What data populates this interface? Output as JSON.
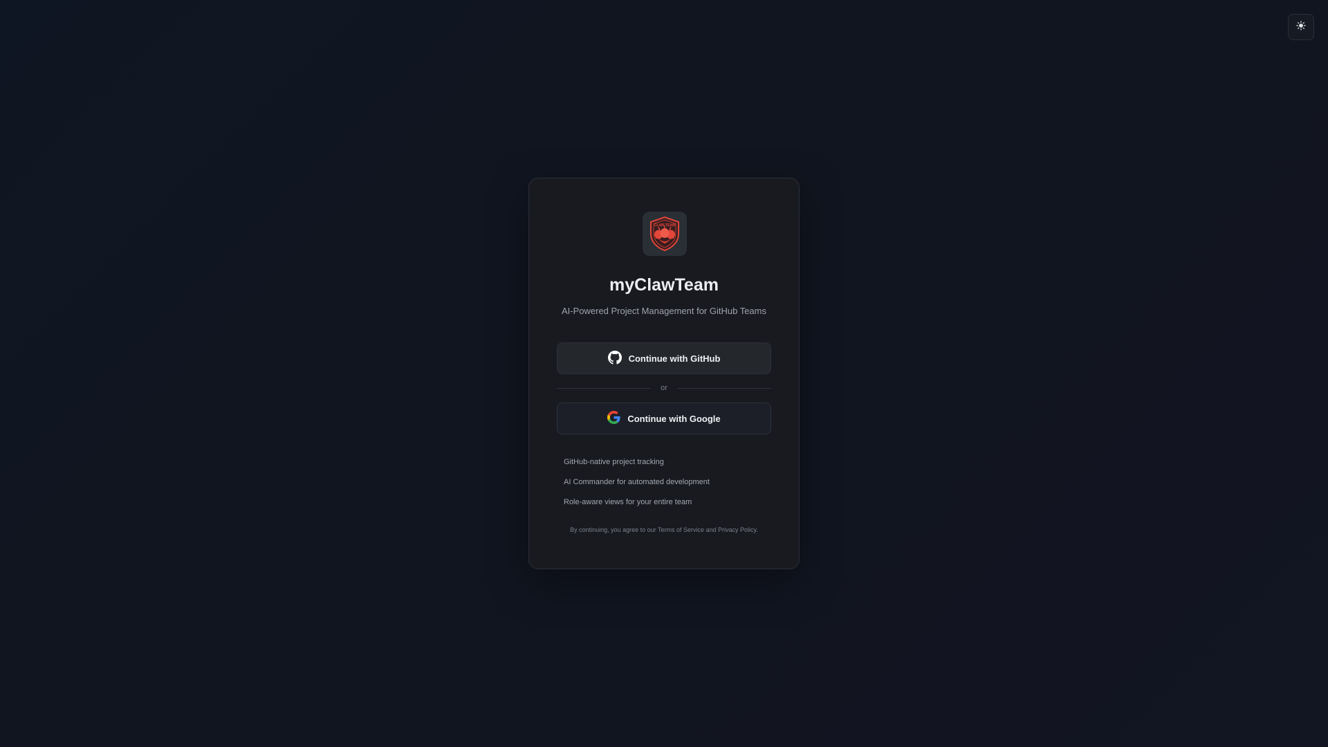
{
  "theme_toggle": {
    "icon": "sun-icon"
  },
  "brand": {
    "logo": "claw-team-shield-logo",
    "logo_text": "CLAW TEAM",
    "name": "myClawTeam",
    "tagline": "AI-Powered Project Management for GitHub Teams"
  },
  "auth": {
    "github_label": "Continue with GitHub",
    "github_icon": "github-icon",
    "divider_text": "or",
    "google_label": "Continue with Google",
    "google_icon": "google-icon"
  },
  "features": [
    "GitHub-native project tracking",
    "AI Commander for automated development",
    "Role-aware views for your entire team"
  ],
  "legal_text": "By continuing, you agree to our Terms of Service and Privacy Policy.",
  "colors": {
    "background": "#11151f",
    "card": "#181a20",
    "logo_red": "#e2473a",
    "google_blue": "#4285F4",
    "google_red": "#EA4335",
    "google_yellow": "#FBBC05",
    "google_green": "#34A853"
  }
}
